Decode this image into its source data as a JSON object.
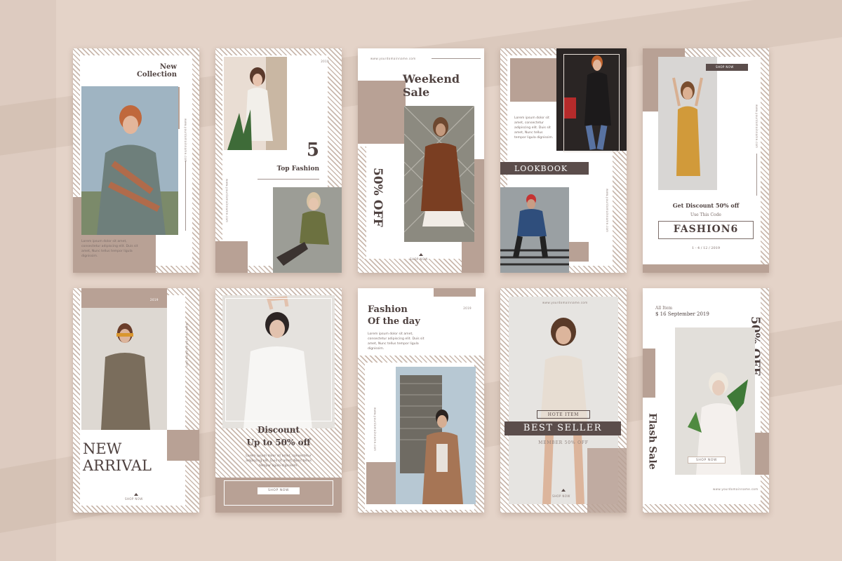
{
  "colors": {
    "background": "#e4d3c8",
    "tan": "#b8a195",
    "dark": "#5b4d4b",
    "text": "#4f4240"
  },
  "lorem": "Lorem ipsum dolor sit amet, consectetur adipiscing elit. Duis sit amet, Nunc tellus tempor ligula dignissim.",
  "website": "www.yourdomainname.com",
  "year": "2019",
  "shop_now": "SHOP NOW",
  "cards": {
    "new_collection": {
      "title_1": "New",
      "title_2": "Collection"
    },
    "top_fashion": {
      "number": "5",
      "title": "Top Fashion"
    },
    "weekend_sale": {
      "title_1": "Weekend",
      "title_2": "Sale",
      "offer": "50% OFF"
    },
    "lookbook": {
      "title": "LOOKBOOK"
    },
    "fashion6": {
      "discount": "Get Discount 50% off",
      "use_code": "Use This Code",
      "code": "FASHION6",
      "dates": "1 - 4 / 12 / 2019"
    },
    "new_arrival": {
      "title_1": "NEW",
      "title_2": "ARRIVAL"
    },
    "discount": {
      "title_1": "Discount",
      "title_2": "Up to 50% off"
    },
    "fashion_day": {
      "title_1": "Fashion",
      "title_2": "Of the day"
    },
    "best_seller": {
      "top": "HOTE ITEM",
      "title": "BEST SELLER",
      "bottom": "MEMBER 50% OFF"
    },
    "flash_sale": {
      "all_item": "All Item",
      "date": "$ 16 September 2019",
      "offer": "50% OFF",
      "title": "Flash Sale"
    }
  }
}
